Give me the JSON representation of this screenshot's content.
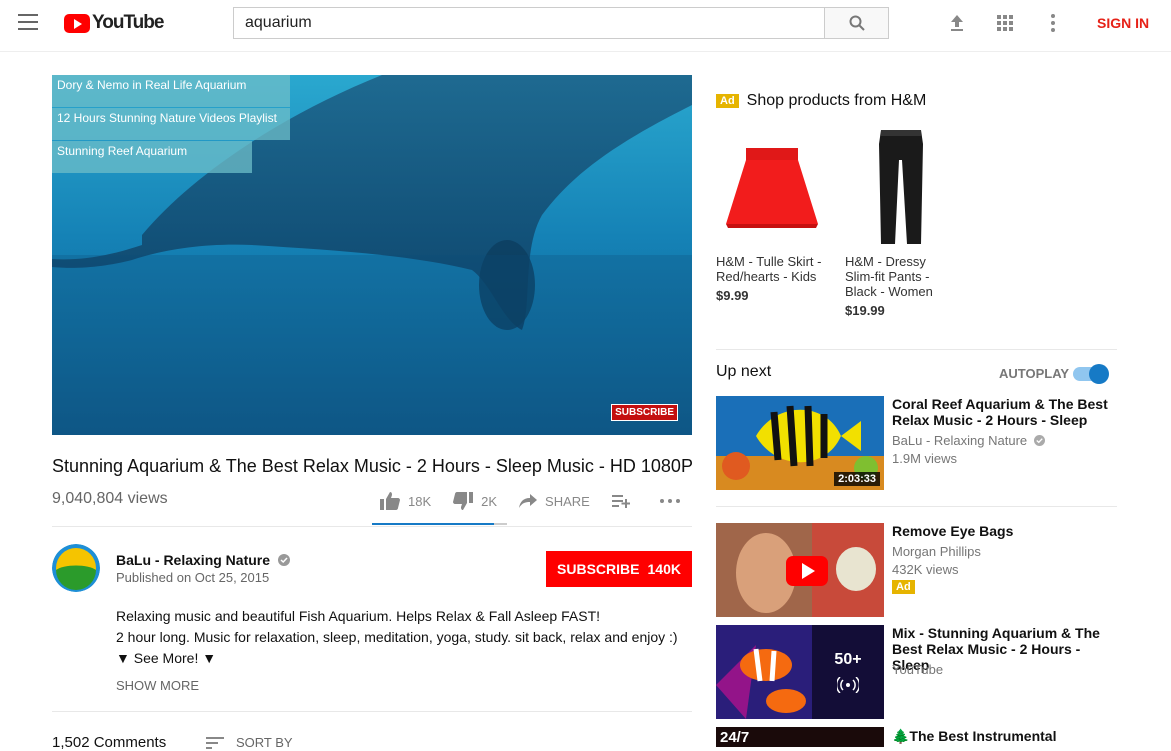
{
  "header": {
    "logo_text": "YouTube",
    "search_value": "aquarium",
    "sign_in": "SIGN IN"
  },
  "player": {
    "cards": [
      "Dory & Nemo in Real Life Aquarium",
      "12 Hours Stunning Nature Videos Playlist",
      "Stunning Reef Aquarium"
    ],
    "watermark": "SUBSCRIBE"
  },
  "video": {
    "title": "Stunning Aquarium & The Best Relax Music - 2 Hours - Sleep Music - HD 1080P",
    "views": "9,040,804 views",
    "likes": "18K",
    "dislikes": "2K",
    "share": "SHARE",
    "like_ratio": 0.9
  },
  "channel": {
    "name": "BaLu - Relaxing Nature",
    "published": "Published on Oct 25, 2015",
    "subscribe_label": "SUBSCRIBE",
    "subscriber_count": "140K"
  },
  "description": {
    "line1": "Relaxing music and beautiful Fish Aquarium.  Helps Relax & Fall Asleep FAST!",
    "line2": "2 hour long.  Music for relaxation, sleep, meditation, yoga, study. sit back, relax and enjoy :)",
    "line3": "▼ See More! ▼",
    "show_more": "SHOW MORE"
  },
  "comments": {
    "count": "1,502 Comments",
    "sort_by": "SORT BY"
  },
  "ad": {
    "badge": "Ad",
    "heading": "Shop products from H&M",
    "products": [
      {
        "name": "H&M - Tulle Skirt - Red/hearts - Kids",
        "price": "$9.99"
      },
      {
        "name": "H&M - Dressy Slim-fit Pants - Black - Women",
        "price": "$19.99"
      }
    ]
  },
  "upnext": {
    "title": "Up next",
    "autoplay": "AUTOPLAY",
    "autoplay_on": true
  },
  "recommendations": [
    {
      "title": "Coral Reef Aquarium & The Best Relax Music - 2 Hours - Sleep",
      "channel": "BaLu - Relaxing Nature",
      "views": "1.9M views",
      "duration": "2:03:33"
    },
    {
      "title": "Remove Eye Bags",
      "channel": "Morgan Phillips",
      "views": "432K views",
      "ad": "Ad"
    },
    {
      "title": "Mix - Stunning Aquarium & The Best Relax Music - 2 Hours - Sleep",
      "channel": "YouTube",
      "playlist_count": "50+"
    },
    {
      "title": "🌲The Best Instrumental",
      "thumb_label": "24/7"
    }
  ]
}
